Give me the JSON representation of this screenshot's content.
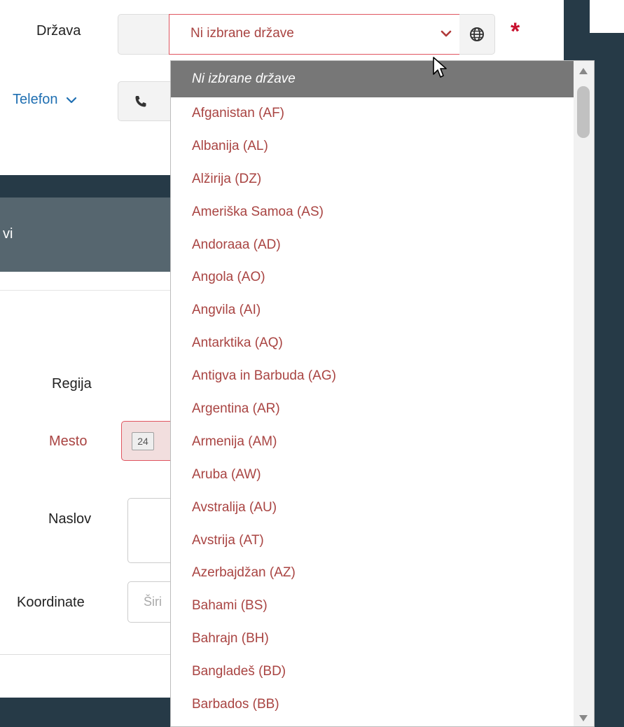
{
  "country_field": {
    "label": "Država",
    "selected_value": "Ni izbrane države",
    "required_marker": "*",
    "globe_icon": "globe-icon",
    "chevron_icon": "chevron-down-icon"
  },
  "phone_field": {
    "toggle_label": "Telefon",
    "phone_icon": "phone-icon"
  },
  "section_header": {
    "partial_title": "vi"
  },
  "form": {
    "regija_label": "Regija",
    "mesto_label": "Mesto",
    "mesto_badge": "24",
    "naslov_label": "Naslov",
    "koordinate_label": "Koordinate",
    "koordinate_placeholder": "Širi"
  },
  "dropdown": {
    "options": [
      "Ni izbrane države",
      "Afganistan (AF)",
      "Albanija (AL)",
      "Alžirija (DZ)",
      "Ameriška Samoa (AS)",
      "Andoraaa (AD)",
      "Angola (AO)",
      "Angvila (AI)",
      "Antarktika (AQ)",
      "Antigva in Barbuda (AG)",
      "Argentina (AR)",
      "Armenija (AM)",
      "Aruba (AW)",
      "Avstralija (AU)",
      "Avstrija (AT)",
      "Azerbajdžan (AZ)",
      "Bahami (BS)",
      "Bahrajn (BH)",
      "Bangladeš (BD)",
      "Barbados (BB)"
    ],
    "selected_index": 0
  },
  "colors": {
    "accent_red": "#a94442",
    "required_red": "#c8102e",
    "link_blue": "#1f6fb2",
    "dark_band": "#263a47",
    "selected_option_bg": "#777777"
  }
}
